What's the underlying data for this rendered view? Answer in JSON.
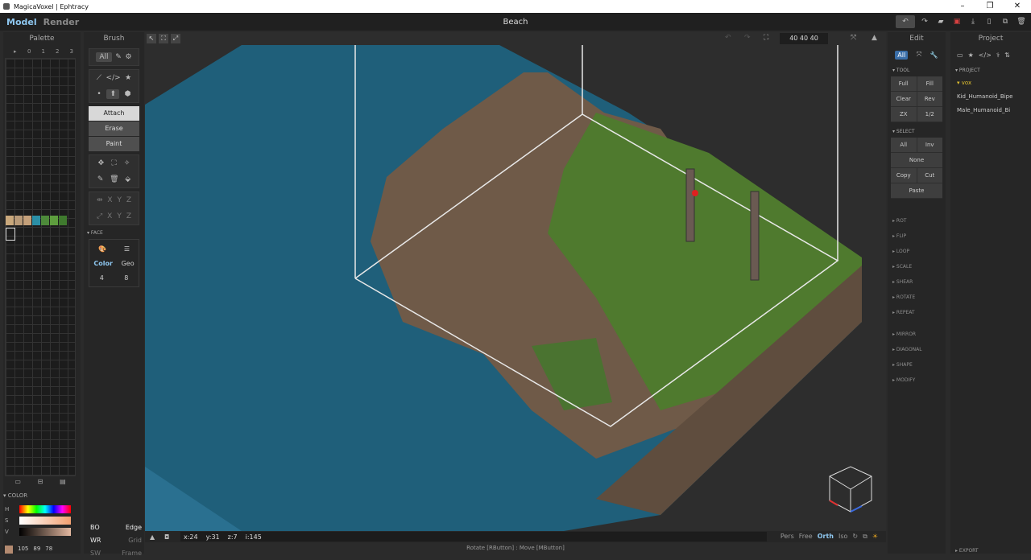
{
  "window": {
    "title": "MagicaVoxel | Ephtracy",
    "min": "–",
    "max": "❐",
    "close": "✕"
  },
  "menu": {
    "model": "Model",
    "render": "Render",
    "scene_title": "Beach",
    "icons": [
      "undo",
      "redo",
      "open",
      "save",
      "export",
      "new",
      "copy",
      "delete"
    ]
  },
  "palette": {
    "header": "Palette",
    "pages": [
      "▸",
      "0",
      "1",
      "2",
      "3"
    ],
    "swatches": [
      "#c9a87c",
      "#b89a78",
      "#c4a07a",
      "#2b8fa6",
      "#4d8a3a",
      "#5e9e3e",
      "#3f7a2e"
    ],
    "icons": [
      "▭",
      "⊟",
      "▤"
    ]
  },
  "color": {
    "header": "▾ COLOR",
    "h": "H",
    "s": "S",
    "v": "V",
    "values": [
      "105",
      "89",
      "78"
    ]
  },
  "brush": {
    "header": "Brush",
    "row1": [
      "All",
      "✎",
      "⚙"
    ],
    "row2": [
      "⟋",
      "</>",
      "★"
    ],
    "row3": [
      "•",
      "⬆",
      "⬢"
    ],
    "modes": [
      "Attach",
      "Erase",
      "Paint"
    ],
    "row4": [
      "✥",
      "⛶",
      "✧"
    ],
    "row5": [
      "✎",
      "🗑",
      "⬙"
    ],
    "mirror1": [
      "⇹",
      "X",
      "Y",
      "Z"
    ],
    "mirror2": [
      "⤢",
      "X",
      "Y",
      "Z"
    ],
    "face": {
      "header": "▾ FACE",
      "color": "Color",
      "geo": "Geo",
      "n1": "4",
      "n2": "8"
    },
    "flags": [
      [
        "BO",
        "Edge"
      ],
      [
        "WR",
        "Grid"
      ],
      [
        "SW",
        "Frame"
      ]
    ]
  },
  "viewport": {
    "dims": "40 40 40",
    "status": {
      "x": "x:24",
      "y": "y:31",
      "z": "z:7",
      "i": "i:145"
    },
    "modes": [
      "Pers",
      "Free",
      "Orth",
      "Iso"
    ],
    "footer": "Rotate [RButton] : Move [MButton]"
  },
  "edit": {
    "header": "Edit",
    "tabs": [
      "All",
      "⤧",
      "🔧"
    ],
    "tool": "▾ TOOL",
    "tool_rows": [
      [
        "Full",
        "Fill"
      ],
      [
        "Clear",
        "Rev"
      ],
      [
        "ZX",
        "1/2"
      ]
    ],
    "select": "▾ SELECT",
    "select_rows": [
      [
        "All",
        "Inv"
      ],
      [
        "None"
      ],
      [
        "Copy",
        "Cut"
      ],
      [
        "Paste"
      ]
    ],
    "sections": [
      "▸ ROT",
      "▸ FLIP",
      "▸ LOOP",
      "▸ SCALE",
      "▸ SHEAR",
      "▸ ROTATE",
      "▸ REPEAT",
      "▸ MIRROR",
      "▸ DIAGONAL",
      "▸ SHAPE",
      "▸ MODIFY"
    ]
  },
  "project": {
    "header": "Project",
    "section": "▾ PROJECT",
    "folder": "▾ vox",
    "items": [
      "Kid_Humanoid_Bipe",
      "Male_Humanoid_Bi"
    ],
    "export": "▸ EXPORT"
  }
}
